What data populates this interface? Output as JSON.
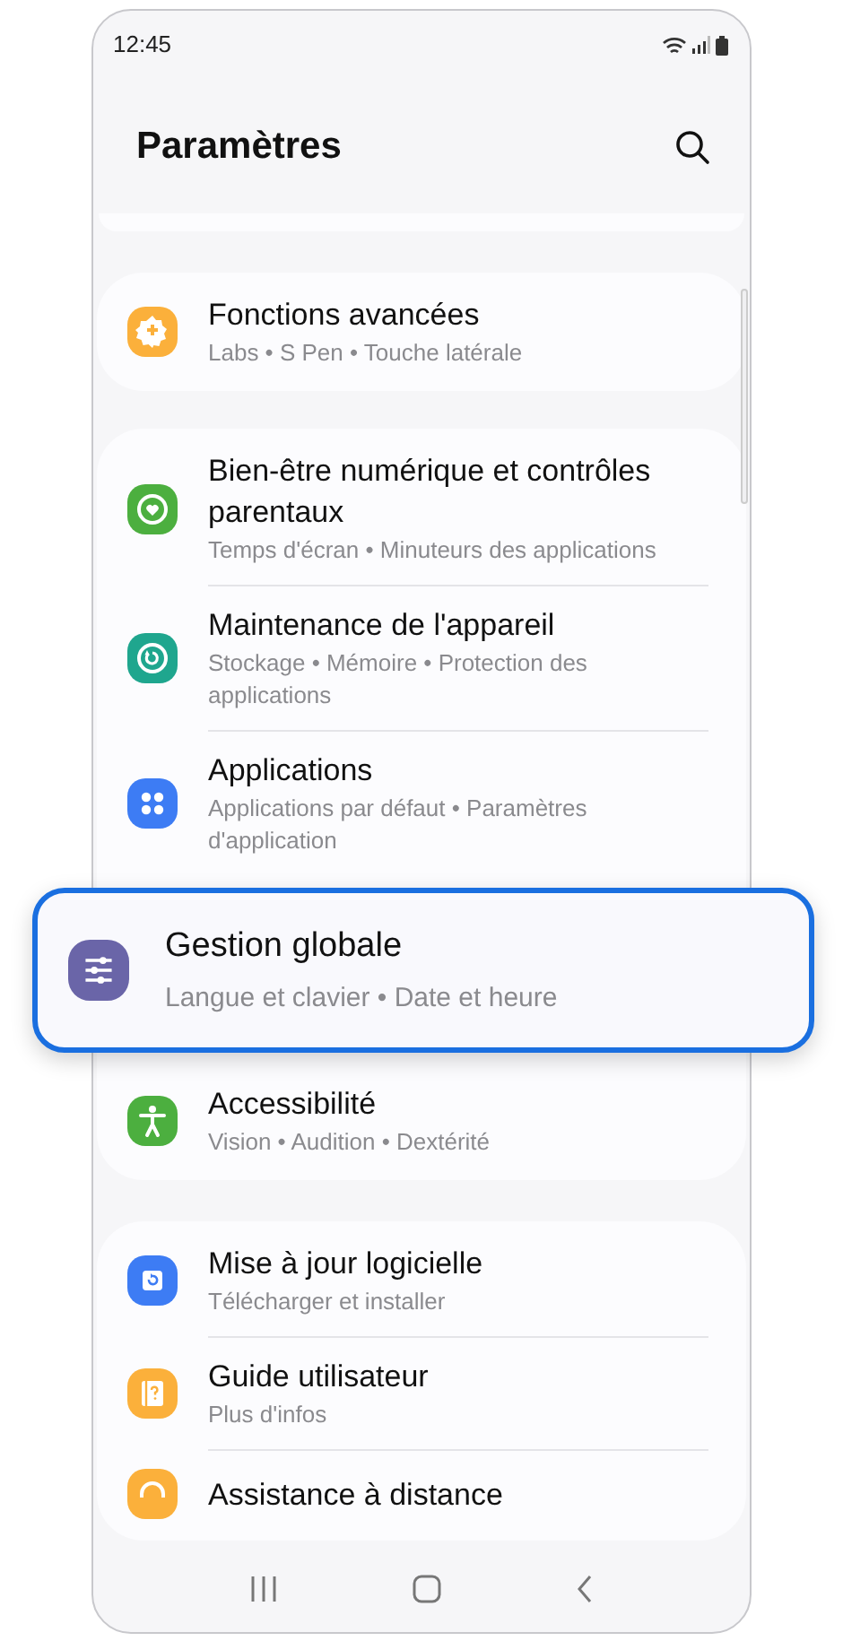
{
  "status_bar": {
    "time": "12:45"
  },
  "header": {
    "title": "Paramètres"
  },
  "groups": [
    {
      "items": [
        {
          "kind": "gear",
          "color": "#fbb03b",
          "title": "Fonctions avancées",
          "subtitle": "Labs • S Pen • Touche latérale",
          "highlighted": false
        }
      ]
    },
    {
      "items": [
        {
          "kind": "heart",
          "color": "#4caf3f",
          "title": "Bien-être numérique et contrôles parentaux",
          "subtitle": "Temps d'écran • Minuteurs des applications",
          "highlighted": false
        },
        {
          "kind": "refresh-circle",
          "color": "#1fa68e",
          "title": "Maintenance de l'appareil",
          "subtitle": "Stockage • Mémoire • Protection des applications",
          "highlighted": false
        },
        {
          "kind": "dots",
          "color": "#3d7cf4",
          "title": "Applications",
          "subtitle": "Applications par défaut • Paramètres d'application",
          "highlighted": false
        },
        {
          "kind": "sliders",
          "color": "#6a65a8",
          "title": "Gestion globale",
          "subtitle": "Langue et clavier • Date et heure",
          "highlighted": true
        },
        {
          "kind": "person",
          "color": "#4caf3f",
          "title": "Accessibilité",
          "subtitle": "Vision • Audition • Dextérité",
          "highlighted": false
        }
      ]
    },
    {
      "items": [
        {
          "kind": "update",
          "color": "#3d7cf4",
          "title": "Mise à jour logicielle",
          "subtitle": "Télécharger et installer",
          "highlighted": false
        },
        {
          "kind": "book",
          "color": "#fbb03b",
          "title": "Guide utilisateur",
          "subtitle": "Plus d'infos",
          "highlighted": false
        },
        {
          "kind": "headset",
          "color": "#fbb03b",
          "title": "Assistance à distance",
          "highlighted": false
        }
      ]
    }
  ]
}
